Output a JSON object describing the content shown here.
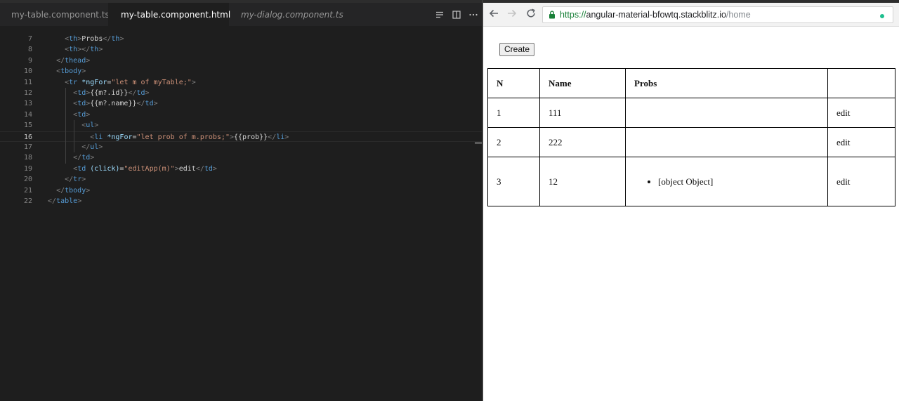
{
  "editor": {
    "tabs": [
      {
        "label": "my-table.component.ts",
        "icon": "angular-icon",
        "active": false,
        "italic": false
      },
      {
        "label": "my-table.component.html",
        "icon": "html5-icon",
        "active": true,
        "italic": false,
        "modified": true
      },
      {
        "label": "my-dialog.component.ts",
        "icon": "angular-icon",
        "active": false,
        "italic": true
      }
    ],
    "actions": [
      "more-actions-icon"
    ],
    "current_line": "16",
    "lines": [
      {
        "n": "7",
        "tokens": [
          {
            "c": "t-punc",
            "t": "      <"
          },
          {
            "c": "t-tag",
            "t": "th"
          },
          {
            "c": "t-punc",
            "t": ">"
          },
          {
            "c": "t-text",
            "t": "Probs"
          },
          {
            "c": "t-punc",
            "t": "</"
          },
          {
            "c": "t-tag",
            "t": "th"
          },
          {
            "c": "t-punc",
            "t": ">"
          }
        ]
      },
      {
        "n": "8",
        "tokens": [
          {
            "c": "t-punc",
            "t": "      <"
          },
          {
            "c": "t-tag",
            "t": "th"
          },
          {
            "c": "t-punc",
            "t": "></"
          },
          {
            "c": "t-tag",
            "t": "th"
          },
          {
            "c": "t-punc",
            "t": ">"
          }
        ]
      },
      {
        "n": "9",
        "tokens": [
          {
            "c": "t-punc",
            "t": "    </"
          },
          {
            "c": "t-tag",
            "t": "thead"
          },
          {
            "c": "t-punc",
            "t": ">"
          }
        ]
      },
      {
        "n": "10",
        "tokens": [
          {
            "c": "t-punc",
            "t": "    <"
          },
          {
            "c": "t-tag",
            "t": "tbody"
          },
          {
            "c": "t-punc",
            "t": ">"
          }
        ]
      },
      {
        "n": "11",
        "tokens": [
          {
            "c": "t-punc",
            "t": "      <"
          },
          {
            "c": "t-tag",
            "t": "tr"
          },
          {
            "c": "t-text",
            "t": " "
          },
          {
            "c": "t-attr",
            "t": "*ngFor"
          },
          {
            "c": "t-text",
            "t": "="
          },
          {
            "c": "t-str",
            "t": "\"let m of myTable;\""
          },
          {
            "c": "t-punc",
            "t": ">"
          }
        ]
      },
      {
        "n": "12",
        "tokens": [
          {
            "c": "t-punc",
            "t": "        <"
          },
          {
            "c": "t-tag",
            "t": "td"
          },
          {
            "c": "t-punc",
            "t": ">"
          },
          {
            "c": "t-text",
            "t": "{{m?.id}}"
          },
          {
            "c": "t-punc",
            "t": "</"
          },
          {
            "c": "t-tag",
            "t": "td"
          },
          {
            "c": "t-punc",
            "t": ">"
          }
        ]
      },
      {
        "n": "13",
        "tokens": [
          {
            "c": "t-punc",
            "t": "        <"
          },
          {
            "c": "t-tag",
            "t": "td"
          },
          {
            "c": "t-punc",
            "t": ">"
          },
          {
            "c": "t-text",
            "t": "{{m?.name}}"
          },
          {
            "c": "t-punc",
            "t": "</"
          },
          {
            "c": "t-tag",
            "t": "td"
          },
          {
            "c": "t-punc",
            "t": ">"
          }
        ]
      },
      {
        "n": "14",
        "tokens": [
          {
            "c": "t-punc",
            "t": "        <"
          },
          {
            "c": "t-tag",
            "t": "td"
          },
          {
            "c": "t-punc",
            "t": ">"
          }
        ]
      },
      {
        "n": "15",
        "tokens": [
          {
            "c": "t-punc",
            "t": "          <"
          },
          {
            "c": "t-tag",
            "t": "ul"
          },
          {
            "c": "t-punc",
            "t": ">"
          }
        ]
      },
      {
        "n": "16",
        "tokens": [
          {
            "c": "t-punc",
            "t": "            <"
          },
          {
            "c": "t-tag",
            "t": "li"
          },
          {
            "c": "t-text",
            "t": " "
          },
          {
            "c": "t-attr",
            "t": "*ngFor"
          },
          {
            "c": "t-text",
            "t": "="
          },
          {
            "c": "t-str",
            "t": "\"let prob of m.probs;\""
          },
          {
            "c": "t-punc",
            "t": ">"
          },
          {
            "c": "t-text",
            "t": "{{prob}}"
          },
          {
            "c": "t-punc",
            "t": "</"
          },
          {
            "c": "t-tag",
            "t": "li"
          },
          {
            "c": "t-punc",
            "t": ">"
          }
        ]
      },
      {
        "n": "17",
        "tokens": [
          {
            "c": "t-punc",
            "t": "          </"
          },
          {
            "c": "t-tag",
            "t": "ul"
          },
          {
            "c": "t-punc",
            "t": ">"
          }
        ]
      },
      {
        "n": "18",
        "tokens": [
          {
            "c": "t-punc",
            "t": "        </"
          },
          {
            "c": "t-tag",
            "t": "td"
          },
          {
            "c": "t-punc",
            "t": ">"
          }
        ]
      },
      {
        "n": "19",
        "tokens": [
          {
            "c": "t-punc",
            "t": "        <"
          },
          {
            "c": "t-tag",
            "t": "td"
          },
          {
            "c": "t-text",
            "t": " "
          },
          {
            "c": "t-attr",
            "t": "(click)"
          },
          {
            "c": "t-text",
            "t": "="
          },
          {
            "c": "t-str",
            "t": "\"editApp(m)\""
          },
          {
            "c": "t-punc",
            "t": ">"
          },
          {
            "c": "t-text",
            "t": "edit"
          },
          {
            "c": "t-punc",
            "t": "</"
          },
          {
            "c": "t-tag",
            "t": "td"
          },
          {
            "c": "t-punc",
            "t": ">"
          }
        ]
      },
      {
        "n": "20",
        "tokens": [
          {
            "c": "t-punc",
            "t": "      </"
          },
          {
            "c": "t-tag",
            "t": "tr"
          },
          {
            "c": "t-punc",
            "t": ">"
          }
        ]
      },
      {
        "n": "21",
        "tokens": [
          {
            "c": "t-punc",
            "t": "    </"
          },
          {
            "c": "t-tag",
            "t": "tbody"
          },
          {
            "c": "t-punc",
            "t": ">"
          }
        ]
      },
      {
        "n": "22",
        "tokens": [
          {
            "c": "t-punc",
            "t": "  </"
          },
          {
            "c": "t-tag",
            "t": "table"
          },
          {
            "c": "t-punc",
            "t": ">"
          }
        ]
      }
    ]
  },
  "browser": {
    "url_scheme": "https://",
    "url_host": "angular-material-bfowtq.stackblitz.io",
    "url_path": "/home",
    "page": {
      "create_label": "Create",
      "table": {
        "headers": [
          "N",
          "Name",
          "Probs",
          ""
        ],
        "rows": [
          {
            "n": "1",
            "name": "111",
            "probs": [],
            "action": "edit"
          },
          {
            "n": "2",
            "name": "222",
            "probs": [],
            "action": "edit"
          },
          {
            "n": "3",
            "name": "12",
            "probs": [
              "[object Object]"
            ],
            "action": "edit"
          }
        ]
      }
    }
  }
}
